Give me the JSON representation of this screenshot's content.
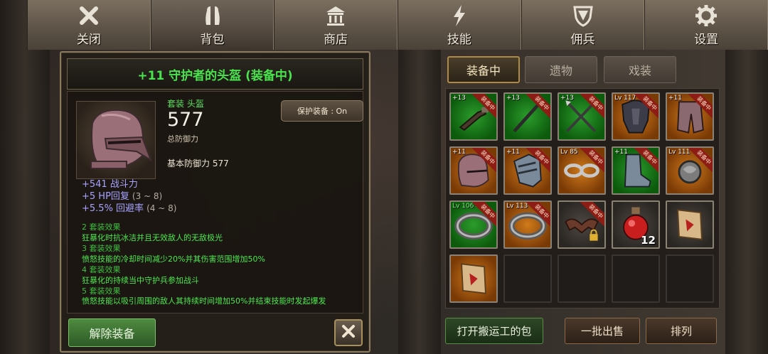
{
  "nav": {
    "tabs": [
      {
        "label": "关闭",
        "icon": "close-x-icon"
      },
      {
        "label": "背包",
        "icon": "backpack-icon"
      },
      {
        "label": "商店",
        "icon": "shop-temple-icon"
      },
      {
        "label": "技能",
        "icon": "lightning-icon"
      },
      {
        "label": "佣兵",
        "icon": "shield-icon"
      },
      {
        "label": "设置",
        "icon": "gear-icon"
      }
    ],
    "active": "背包"
  },
  "detail": {
    "title": "+11 守护者的头盔 (装备中)",
    "type_line": "套装 头盔",
    "defense_value": "577",
    "defense_label": "总防御力",
    "base_line": "基本防御力 577",
    "protect_label": "保护装备 : On",
    "stats": [
      {
        "text": "+541 战斗力",
        "range": ""
      },
      {
        "text": "+5 HP回复",
        "range": "(3 ~ 8)"
      },
      {
        "text": "+5.5% 回避率",
        "range": "(4 ~ 8)"
      }
    ],
    "set_effects": [
      {
        "header": "2 套装效果",
        "desc": "狂暴化时抗冰洁并且无效敌人的无敌极光"
      },
      {
        "header": "3 套装效果",
        "desc": "愤怒技能的冷却时间减少20%并其伤害范围增加50%"
      },
      {
        "header": "4 套装效果",
        "desc": "狂暴化的持续当中守护兵参加战斗"
      },
      {
        "header": "5 套装效果",
        "desc": "愤怒技能以吸引周围的敌人其持续时间增加50%并结束技能时发起爆发"
      }
    ],
    "unequip_label": "解除装备"
  },
  "right_tabs": [
    "装备中",
    "遗物",
    "戏装"
  ],
  "right_tab_active": "装备中",
  "equipped_ribbon": "装备中",
  "inventory": [
    {
      "icon": "pistol-icon",
      "label": "+13",
      "bg": "green",
      "equipped": true
    },
    {
      "icon": "spear-icon",
      "label": "+13",
      "bg": "green",
      "equipped": true
    },
    {
      "icon": "crossed-spears-icon",
      "label": "+13",
      "bg": "green",
      "equipped": true
    },
    {
      "icon": "armor-icon",
      "label": "Lv 117",
      "bg": "orange",
      "equipped": true
    },
    {
      "icon": "greaves-icon",
      "label": "+11",
      "bg": "orange",
      "equipped": true
    },
    {
      "icon": "helmet-icon",
      "label": "+11",
      "bg": "orange",
      "equipped": true
    },
    {
      "icon": "gauntlet-icon",
      "label": "+11",
      "bg": "orange",
      "equipped": true
    },
    {
      "icon": "chain-icon",
      "label": "Lv 85",
      "bg": "orange",
      "equipped": true
    },
    {
      "icon": "boots-icon",
      "label": "+11",
      "bg": "green",
      "equipped": true
    },
    {
      "icon": "amulet-icon",
      "label": "Lv 111",
      "bg": "orange",
      "equipped": true
    },
    {
      "icon": "ring-icon",
      "label": "Lv 106",
      "bg": "green",
      "equipped": true
    },
    {
      "icon": "ring-icon",
      "label": "Lv 113",
      "bg": "orange",
      "equipped": true
    },
    {
      "icon": "bat-wings-locked-icon",
      "label": "",
      "bg": "dark",
      "equipped": true
    },
    {
      "icon": "red-potion-icon",
      "label": "",
      "bg": "dark",
      "equipped": false,
      "qty": "12"
    },
    {
      "icon": "scroll-icon",
      "label": "",
      "bg": "dark",
      "equipped": false
    },
    {
      "icon": "scroll-icon",
      "label": "",
      "bg": "orange",
      "equipped": false
    },
    {
      "icon": "",
      "label": "",
      "bg": "empty",
      "equipped": false
    },
    {
      "icon": "",
      "label": "",
      "bg": "empty",
      "equipped": false
    },
    {
      "icon": "",
      "label": "",
      "bg": "empty",
      "equipped": false
    },
    {
      "icon": "",
      "label": "",
      "bg": "empty",
      "equipped": false
    }
  ],
  "actions": {
    "open_porter_bag": "打开搬运工的包",
    "bulk_sell": "一批出售",
    "sort": "排列"
  },
  "colors": {
    "title_green": "#49e34d",
    "stat_purple": "#a8a4ff",
    "set_green": "#4ee84e",
    "equipped_ribbon": "#8c1c14"
  }
}
